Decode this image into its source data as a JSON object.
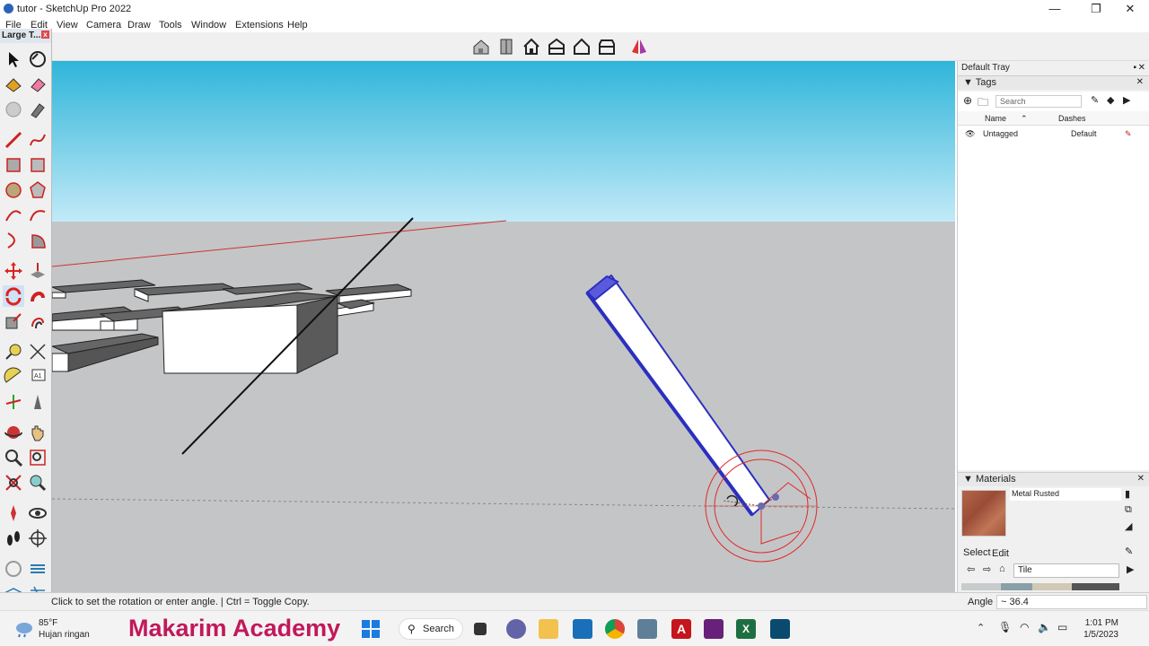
{
  "window": {
    "title": "tutor - SketchUp Pro 2022"
  },
  "menu": [
    "File",
    "Edit",
    "View",
    "Camera",
    "Draw",
    "Tools",
    "Window",
    "Extensions",
    "Help"
  ],
  "large_tool_set": {
    "title": "Large T..."
  },
  "tray": {
    "title": "Default Tray",
    "tags": {
      "header": "Tags",
      "search_placeholder": "Search",
      "columns": [
        "Name",
        "Dashes"
      ],
      "rows": [
        {
          "name": "Untagged",
          "dashes": "Default"
        }
      ]
    },
    "materials": {
      "header": "Materials",
      "current": "Metal Rusted",
      "tabs": [
        "Select",
        "Edit"
      ],
      "library": "Tile"
    }
  },
  "status": {
    "message": "Click to set the rotation or enter angle. | Ctrl = Toggle Copy.",
    "vcb_label": "Angle",
    "vcb_value": "~ 36.4"
  },
  "taskbar": {
    "weather_temp": "85°F",
    "weather_desc": "Hujan ringan",
    "watermark": "Makarim Academy",
    "search": "Search",
    "time": "1:01 PM",
    "date": "1/5/2023"
  },
  "colors": {
    "sky_top": "#2fb5da",
    "sky_bottom": "#bfe9f6",
    "ground": "#c4c5c7",
    "protractor": "#e02a2a",
    "selection": "#2b2fbf"
  }
}
